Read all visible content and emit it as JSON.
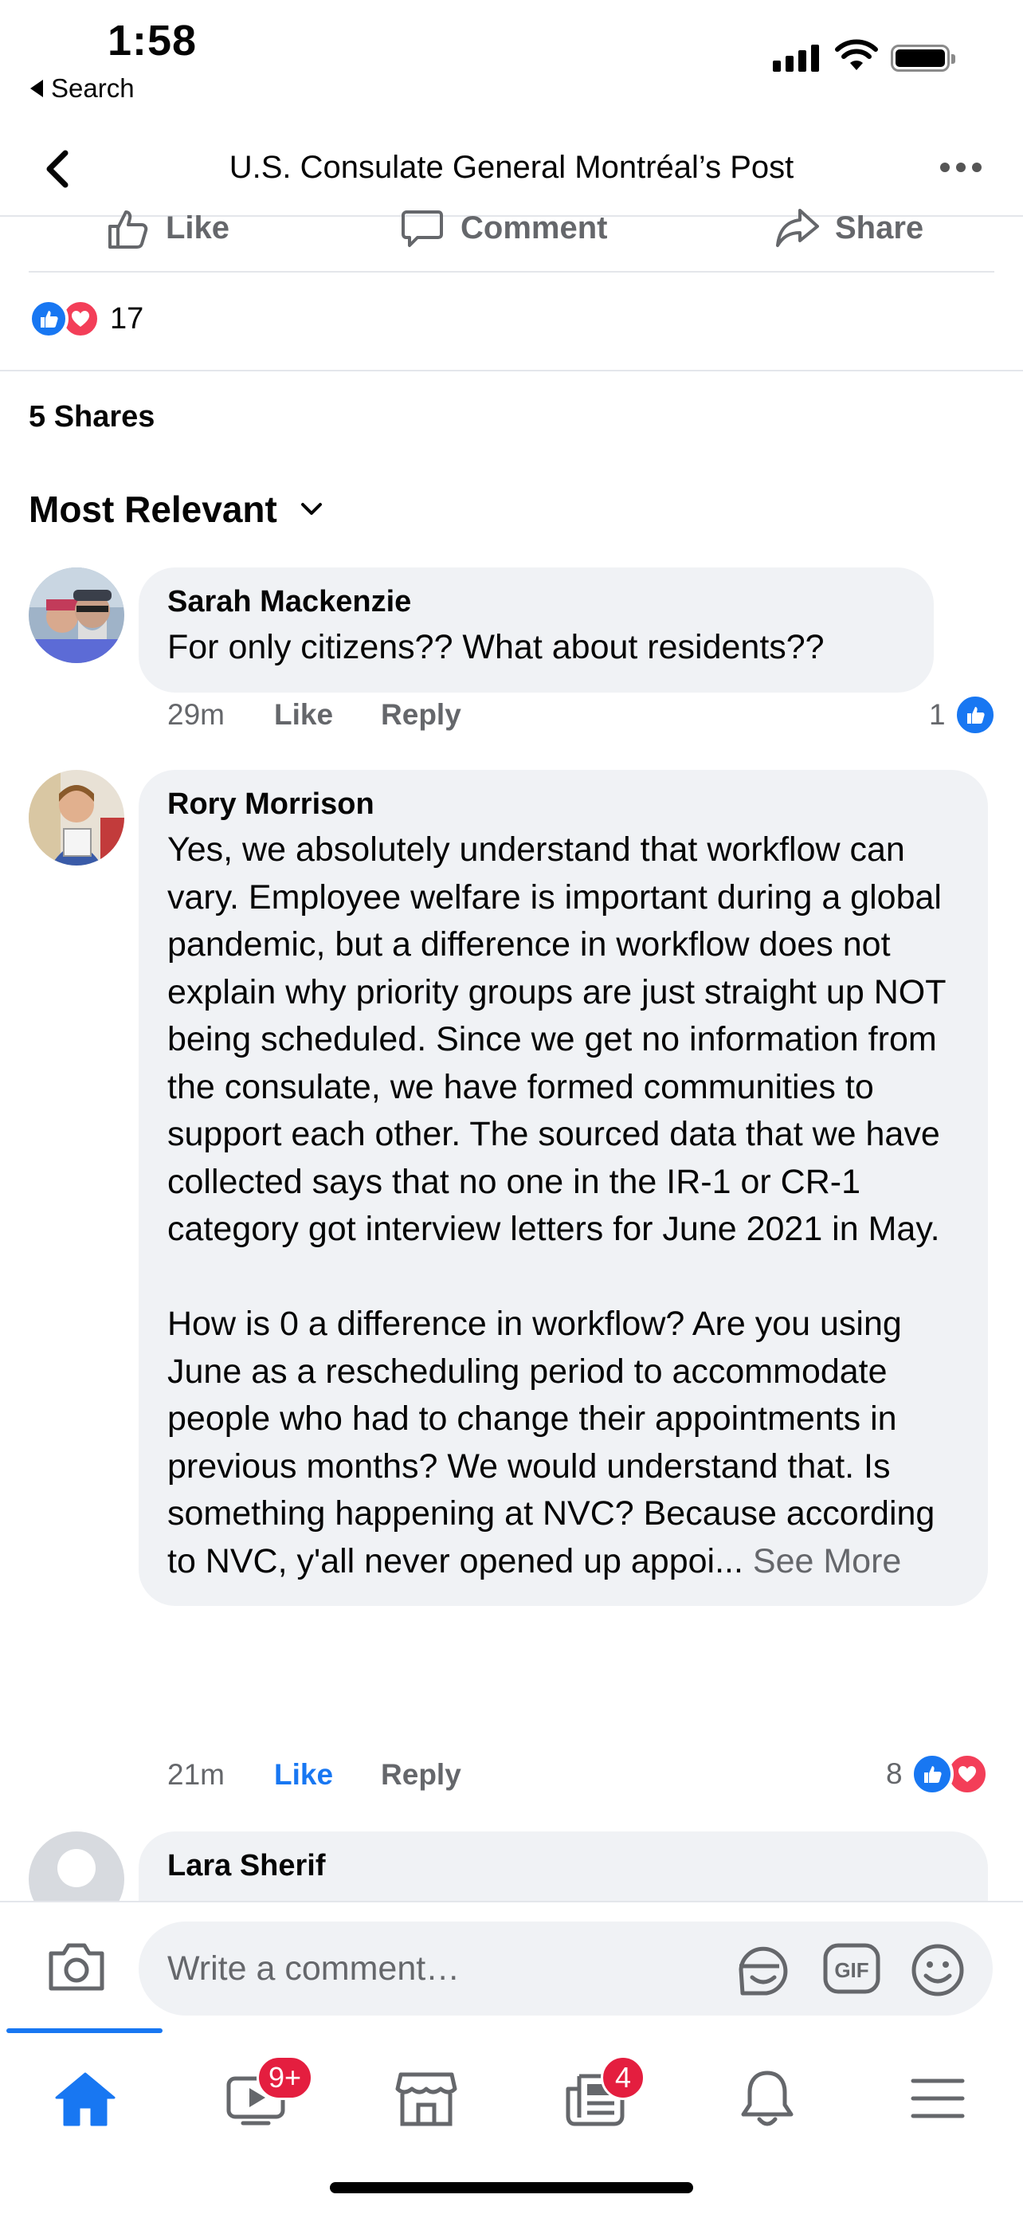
{
  "status_bar": {
    "time": "1:58",
    "back_label": "Search"
  },
  "header": {
    "title": "U.S. Consulate General Montréal’s Post"
  },
  "post_actions": {
    "like": "Like",
    "comment": "Comment",
    "share": "Share"
  },
  "reactions": {
    "count": "17"
  },
  "shares": "5 Shares",
  "sort": {
    "label": "Most Relevant"
  },
  "comments": [
    {
      "name": "Sarah Mackenzie",
      "text": "For only citizens?? What about residents??",
      "time": "29m",
      "like": "Like",
      "reply": "Reply",
      "reaction_count": "1",
      "liked": false
    },
    {
      "name": "Rory Morrison",
      "text": "Yes, we absolutely understand that workflow can vary. Employee welfare is important during a global pandemic, but a difference in workflow does not explain why priority groups are just straight up NOT being scheduled. Since we get no information from the consulate, we have formed communities to support each other. The sourced data that we have collected says that no one in the IR-1 or CR-1 category got interview letters for June 2021 in May.\n\nHow is 0 a difference in workflow? Are you using June as a rescheduling period to accommodate people who had to change their appointments in previous months? We would understand that. Is something happening at NVC? Because according to NVC, y'all never opened up appoi...",
      "see_more": "See More",
      "time": "21m",
      "like": "Like",
      "reply": "Reply",
      "reaction_count": "8",
      "liked": true
    },
    {
      "name": "Lara Sherif"
    }
  ],
  "composer": {
    "placeholder": "Write a comment…"
  },
  "tabbar": {
    "video_badge": "9+",
    "news_badge": "4"
  },
  "colors": {
    "accent": "#1877f2",
    "love": "#f33e58",
    "badge": "#e41e3f",
    "bubble": "#f0f2f5"
  }
}
